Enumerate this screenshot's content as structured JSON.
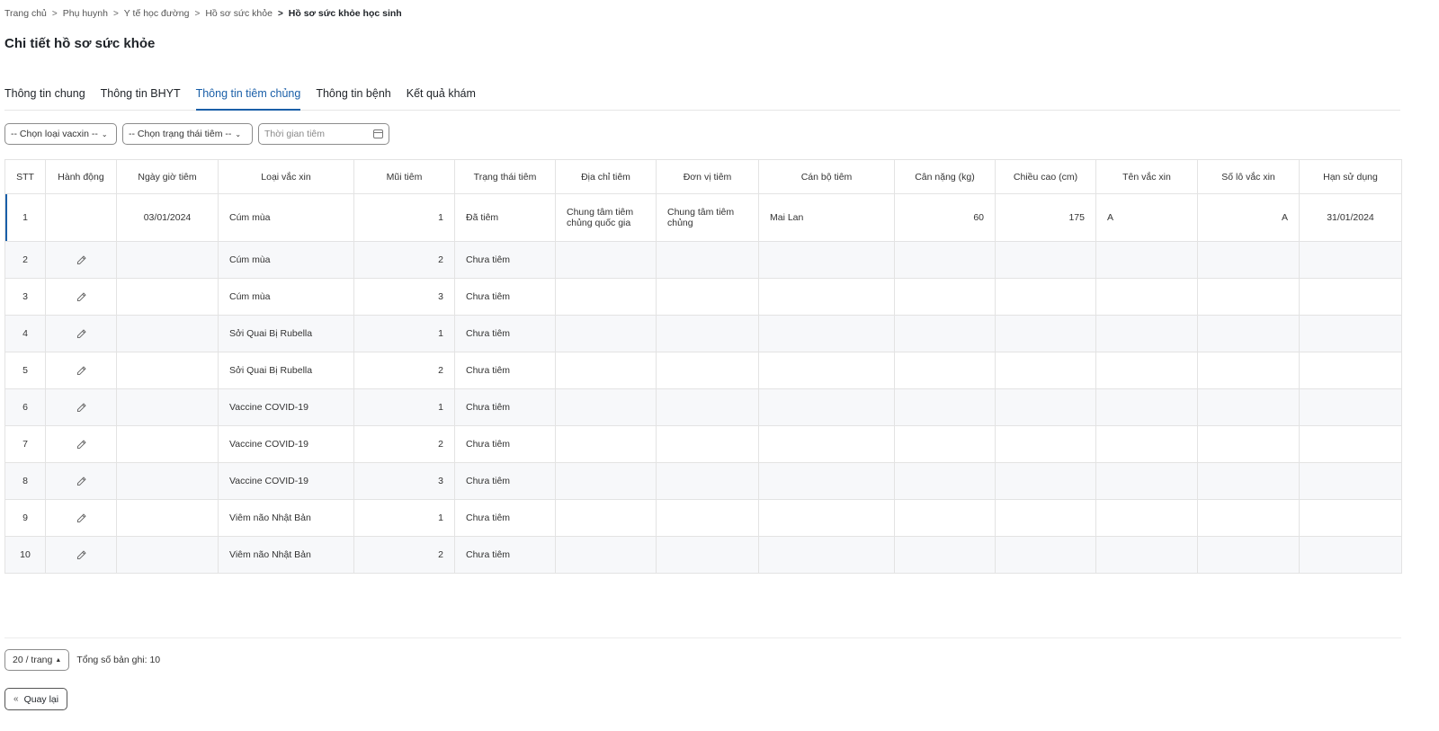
{
  "breadcrumb": {
    "items": [
      "Trang chủ",
      "Phụ huynh",
      "Y tế học đường",
      "Hồ sơ sức khỏe"
    ],
    "current": "Hồ sơ sức khỏe học sinh"
  },
  "page_title": "Chi tiết hồ sơ sức khỏe",
  "tabs": [
    {
      "label": "Thông tin chung",
      "active": false
    },
    {
      "label": "Thông tin BHYT",
      "active": false
    },
    {
      "label": "Thông tin tiêm chủng",
      "active": true
    },
    {
      "label": "Thông tin bệnh",
      "active": false
    },
    {
      "label": "Kết quả khám",
      "active": false
    }
  ],
  "filters": {
    "vaccine_type": "-- Chọn loại vacxin --",
    "status": "-- Chọn trạng thái tiêm --",
    "date_placeholder": "Thời gian tiêm"
  },
  "table": {
    "headers": [
      "STT",
      "Hành động",
      "Ngày giờ tiêm",
      "Loại vắc xin",
      "Mũi tiêm",
      "Trạng thái tiêm",
      "Địa chỉ tiêm",
      "Đơn vị tiêm",
      "Cán bộ tiêm",
      "Cân nặng (kg)",
      "Chiều cao (cm)",
      "Tên vắc xin",
      "Số lô vắc xin",
      "Hạn sử dụng"
    ],
    "rows": [
      {
        "stt": "1",
        "editable": false,
        "date": "03/01/2024",
        "vaccine": "Cúm mùa",
        "dose": "1",
        "status": "Đã tiêm",
        "address": "Chung tâm tiêm chủng quốc gia",
        "unit": "Chung tâm tiêm chủng",
        "staff": "Mai Lan",
        "weight": "60",
        "height": "175",
        "vaccine_name": "A",
        "lot": "A",
        "expiry": "31/01/2024"
      },
      {
        "stt": "2",
        "editable": true,
        "date": "",
        "vaccine": "Cúm mùa",
        "dose": "2",
        "status": "Chưa tiêm",
        "address": "",
        "unit": "",
        "staff": "",
        "weight": "",
        "height": "",
        "vaccine_name": "",
        "lot": "",
        "expiry": ""
      },
      {
        "stt": "3",
        "editable": true,
        "date": "",
        "vaccine": "Cúm mùa",
        "dose": "3",
        "status": "Chưa tiêm",
        "address": "",
        "unit": "",
        "staff": "",
        "weight": "",
        "height": "",
        "vaccine_name": "",
        "lot": "",
        "expiry": ""
      },
      {
        "stt": "4",
        "editable": true,
        "date": "",
        "vaccine": "Sởi Quai Bị Rubella",
        "dose": "1",
        "status": "Chưa tiêm",
        "address": "",
        "unit": "",
        "staff": "",
        "weight": "",
        "height": "",
        "vaccine_name": "",
        "lot": "",
        "expiry": ""
      },
      {
        "stt": "5",
        "editable": true,
        "date": "",
        "vaccine": "Sởi Quai Bị Rubella",
        "dose": "2",
        "status": "Chưa tiêm",
        "address": "",
        "unit": "",
        "staff": "",
        "weight": "",
        "height": "",
        "vaccine_name": "",
        "lot": "",
        "expiry": ""
      },
      {
        "stt": "6",
        "editable": true,
        "date": "",
        "vaccine": "Vaccine COVID-19",
        "dose": "1",
        "status": "Chưa tiêm",
        "address": "",
        "unit": "",
        "staff": "",
        "weight": "",
        "height": "",
        "vaccine_name": "",
        "lot": "",
        "expiry": ""
      },
      {
        "stt": "7",
        "editable": true,
        "date": "",
        "vaccine": "Vaccine COVID-19",
        "dose": "2",
        "status": "Chưa tiêm",
        "address": "",
        "unit": "",
        "staff": "",
        "weight": "",
        "height": "",
        "vaccine_name": "",
        "lot": "",
        "expiry": ""
      },
      {
        "stt": "8",
        "editable": true,
        "date": "",
        "vaccine": "Vaccine COVID-19",
        "dose": "3",
        "status": "Chưa tiêm",
        "address": "",
        "unit": "",
        "staff": "",
        "weight": "",
        "height": "",
        "vaccine_name": "",
        "lot": "",
        "expiry": ""
      },
      {
        "stt": "9",
        "editable": true,
        "date": "",
        "vaccine": "Viêm não Nhật Bản",
        "dose": "1",
        "status": "Chưa tiêm",
        "address": "",
        "unit": "",
        "staff": "",
        "weight": "",
        "height": "",
        "vaccine_name": "",
        "lot": "",
        "expiry": ""
      },
      {
        "stt": "10",
        "editable": true,
        "date": "",
        "vaccine": "Viêm não Nhật Bản",
        "dose": "2",
        "status": "Chưa tiêm",
        "address": "",
        "unit": "",
        "staff": "",
        "weight": "",
        "height": "",
        "vaccine_name": "",
        "lot": "",
        "expiry": ""
      }
    ]
  },
  "pagination": {
    "page_size": "20 / trang",
    "total": "Tổng số bản ghi: 10"
  },
  "back_button": "Quay lại",
  "colors": {
    "accent": "#1a5fa8",
    "border": "#e3e3e3",
    "stripe": "#f7f8fa"
  },
  "icons": {
    "breadcrumb_separator": "chevron-right-icon",
    "edit": "pencil-icon",
    "date_picker": "calendar-icon",
    "back": "double-chevron-left-icon"
  }
}
